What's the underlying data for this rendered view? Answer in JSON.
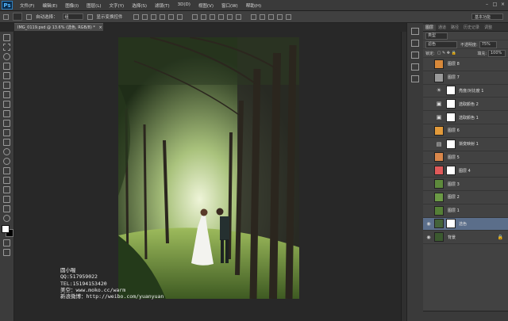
{
  "app": {
    "logo": "Ps"
  },
  "menu": [
    "文件(F)",
    "编辑(E)",
    "图像(I)",
    "图层(L)",
    "文字(Y)",
    "选择(S)",
    "滤镜(T)",
    "3D(D)",
    "视图(V)",
    "窗口(W)",
    "帮助(H)"
  ],
  "window_controls": {
    "minimize": "–",
    "maximize": "□",
    "close": "×"
  },
  "options": {
    "auto_select_label": "自动选择：",
    "auto_select_value": "组",
    "transform_label": "显示变换控件",
    "workspace": "基本功能"
  },
  "document": {
    "tab_title": "IMG_0119.psd @ 13.6% (选色, RGB/8) *",
    "close": "×"
  },
  "photo": {
    "sky": "#cfe6b0",
    "foliage": "#2f4a22",
    "grass": "#7fa84a"
  },
  "watermark": {
    "lines": [
      "圆小喔",
      "QQ:517959022",
      "TEL:15194153420",
      "美空：www.moko.cc/warm",
      "新浪微博：http://weibo.com/yuanyuan"
    ]
  },
  "panel": {
    "tabs": [
      "图层",
      "通道",
      "路径",
      "历史记录",
      "调整"
    ],
    "kind_label": "类型",
    "blend_mode": "滤色",
    "opacity_label": "不透明度:",
    "opacity_value": "75%",
    "lock_label": "锁定:",
    "fill_label": "填充:",
    "fill_value": "100%"
  },
  "layers": [
    {
      "name": "图层 8",
      "thumb": "#d8893a",
      "type": "pixel",
      "visible": false,
      "mask": false
    },
    {
      "name": "图层 7",
      "thumb": "#9a9a9a",
      "type": "pixel",
      "visible": false,
      "mask": false
    },
    {
      "name": "亮度/对比度 1",
      "thumb": "",
      "type": "adjust",
      "adj_icon": "☀",
      "visible": false,
      "mask": true
    },
    {
      "name": "选取颜色 2",
      "thumb": "",
      "type": "adjust",
      "adj_icon": "▣",
      "visible": false,
      "mask": true
    },
    {
      "name": "选取颜色 1",
      "thumb": "",
      "type": "adjust",
      "adj_icon": "▣",
      "visible": false,
      "mask": true
    },
    {
      "name": "图层 6",
      "thumb": "#e29a3a",
      "type": "pixel",
      "visible": false,
      "mask": false
    },
    {
      "name": "渐变映射 1",
      "thumb": "",
      "type": "adjust",
      "adj_icon": "▤",
      "visible": false,
      "mask": true
    },
    {
      "name": "图层 5",
      "thumb": "#d9874b",
      "type": "pixel",
      "visible": false,
      "mask": false
    },
    {
      "name": "图层 4",
      "thumb": "#e05a5a",
      "type": "pixel",
      "visible": false,
      "mask": true
    },
    {
      "name": "图层 3",
      "thumb": "#5e8a3c",
      "type": "pixel",
      "visible": false,
      "mask": false
    },
    {
      "name": "图层 2",
      "thumb": "#6b9a45",
      "type": "pixel",
      "visible": false,
      "mask": false
    },
    {
      "name": "图层 1",
      "thumb": "#557f37",
      "type": "pixel",
      "visible": false,
      "mask": false
    },
    {
      "name": "选色",
      "thumb": "#44633a",
      "type": "pixel",
      "visible": true,
      "mask": true,
      "selected": true
    },
    {
      "name": "背景",
      "thumb": "#3c5a30",
      "type": "pixel",
      "visible": true,
      "mask": false,
      "locked": true
    }
  ]
}
